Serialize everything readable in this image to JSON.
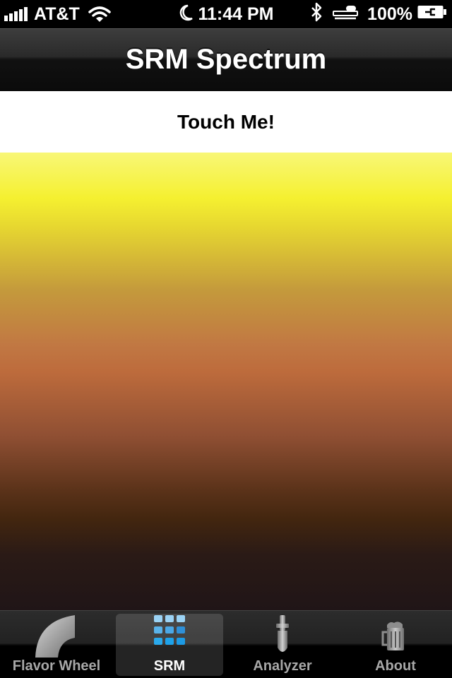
{
  "status_bar": {
    "carrier": "AT&T",
    "time": "11:44 PM",
    "battery_percent": "100%",
    "signal_bars": 5
  },
  "nav": {
    "title": "SRM Spectrum"
  },
  "touch_button": {
    "label": "Touch Me!"
  },
  "spectrum": {
    "colors": [
      "#f8f777",
      "#f5f030",
      "#c49a3c",
      "#bd6b3c",
      "#8f4f33",
      "#43260f",
      "#201517"
    ]
  },
  "tab_bar": {
    "tabs": [
      {
        "label": "Flavor Wheel",
        "icon": "flavor-wheel-icon",
        "selected": false
      },
      {
        "label": "SRM",
        "icon": "grid-icon",
        "selected": true
      },
      {
        "label": "Analyzer",
        "icon": "hydrometer-icon",
        "selected": false
      },
      {
        "label": "About",
        "icon": "beer-mug-icon",
        "selected": false
      }
    ]
  }
}
